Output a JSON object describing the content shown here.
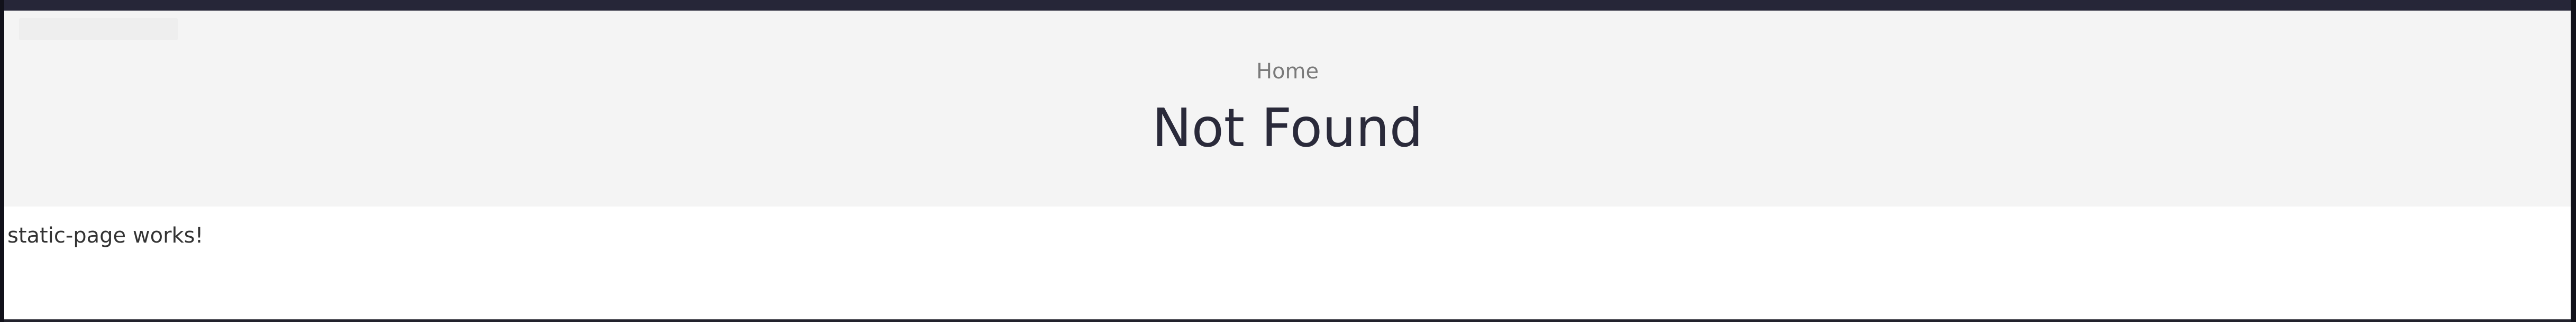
{
  "breadcrumb": {
    "home_label": "Home"
  },
  "page": {
    "title": "Not Found",
    "body_text": "static-page works!"
  },
  "colors": {
    "top_bar": "#262638",
    "hero_background": "#f4f4f4",
    "title_text": "#2a2a3a",
    "breadcrumb_text": "#7a7a7a"
  }
}
